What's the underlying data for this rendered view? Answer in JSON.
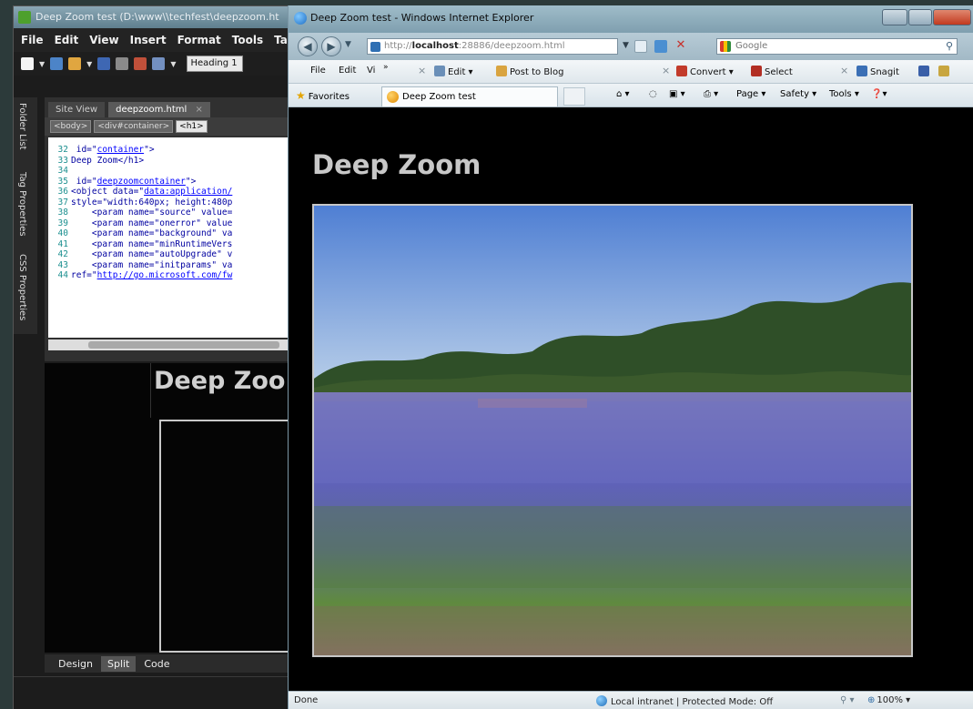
{
  "editor": {
    "title": "Deep Zoom test (D:\\www\\\\techfest\\deepzoom.ht",
    "menu": [
      "File",
      "Edit",
      "View",
      "Insert",
      "Format",
      "Tools",
      "Table"
    ],
    "style_select": "Heading 1",
    "side_tabs": [
      "Folder List",
      "Tag Properties",
      "CSS Properties"
    ],
    "doc_tabs": [
      "Site View",
      "deepzoom.html"
    ],
    "doc_tab_close": "×",
    "breadcrumb": [
      "<body>",
      "<div#container>",
      "<h1>"
    ],
    "code_lines": [
      {
        "n": "32",
        "pre": " id=\"",
        "str": "container",
        "post": "\">"
      },
      {
        "n": "33",
        "pre": "Deep Zoom</h1>",
        "str": "",
        "post": ""
      },
      {
        "n": "34",
        "pre": "",
        "str": "",
        "post": ""
      },
      {
        "n": "35",
        "pre": " id=\"",
        "str": "deepzoomcontainer",
        "post": "\">"
      },
      {
        "n": "36",
        "pre": "<object data=\"",
        "str": "data:application/",
        "post": ""
      },
      {
        "n": "37",
        "pre": "style=\"width:640px; height:480p",
        "str": "",
        "post": ""
      },
      {
        "n": "38",
        "pre": "    <param name=\"source\" value=",
        "str": "",
        "post": ""
      },
      {
        "n": "39",
        "pre": "    <param name=\"onerror\" value",
        "str": "",
        "post": ""
      },
      {
        "n": "40",
        "pre": "    <param name=\"background\" va",
        "str": "",
        "post": ""
      },
      {
        "n": "41",
        "pre": "    <param name=\"minRuntimeVers",
        "str": "",
        "post": ""
      },
      {
        "n": "42",
        "pre": "    <param name=\"autoUpgrade\" v",
        "str": "",
        "post": ""
      },
      {
        "n": "43",
        "pre": "    <param name=\"initparams\" va",
        "str": "",
        "post": ""
      },
      {
        "n": "44",
        "pre": "ref=\"",
        "str": "http://go.microsoft.com/fw",
        "post": ""
      }
    ],
    "design_heading": "Deep Zoo",
    "view_tabs": [
      "Design",
      "Split",
      "Code"
    ],
    "view_tab_active": "Split"
  },
  "browser": {
    "title": "Deep Zoom test - Windows Internet Explorer",
    "url_prefix": "http://",
    "url_host": "localhost",
    "url_rest": ":28886/deepzoom.html",
    "search_placeholder": "Google",
    "command_bar": {
      "file": "File",
      "edit": "Edit",
      "view": "Vi",
      "more": "»",
      "close1": "×",
      "edit_btn": "Edit",
      "post_to_blog": "Post to Blog",
      "close2": "×",
      "convert": "Convert",
      "select": "Select",
      "close3": "×",
      "snagit": "Snagit"
    },
    "favorites_label": "Favorites",
    "tab_title": "Deep Zoom test",
    "page_menu": "Page",
    "safety_menu": "Safety",
    "tools_menu": "Tools",
    "page_heading": "Deep Zoom",
    "status": {
      "text": "Done",
      "zone": "Local intranet | Protected Mode: Off",
      "zoom": "100%"
    }
  },
  "colors": {
    "page_background": "#000000",
    "heading_text": "#c8c8c8",
    "sky": "#5a86d6",
    "flowers": "#6a6fc2",
    "grass": "#5f8a3f"
  },
  "icons": {
    "back": "back-arrow-icon",
    "forward": "forward-arrow-icon",
    "refresh": "refresh-icon",
    "stop": "stop-icon",
    "search": "search-icon",
    "favorites": "star-icon",
    "zone": "globe-icon",
    "zoom": "zoom-icon"
  }
}
